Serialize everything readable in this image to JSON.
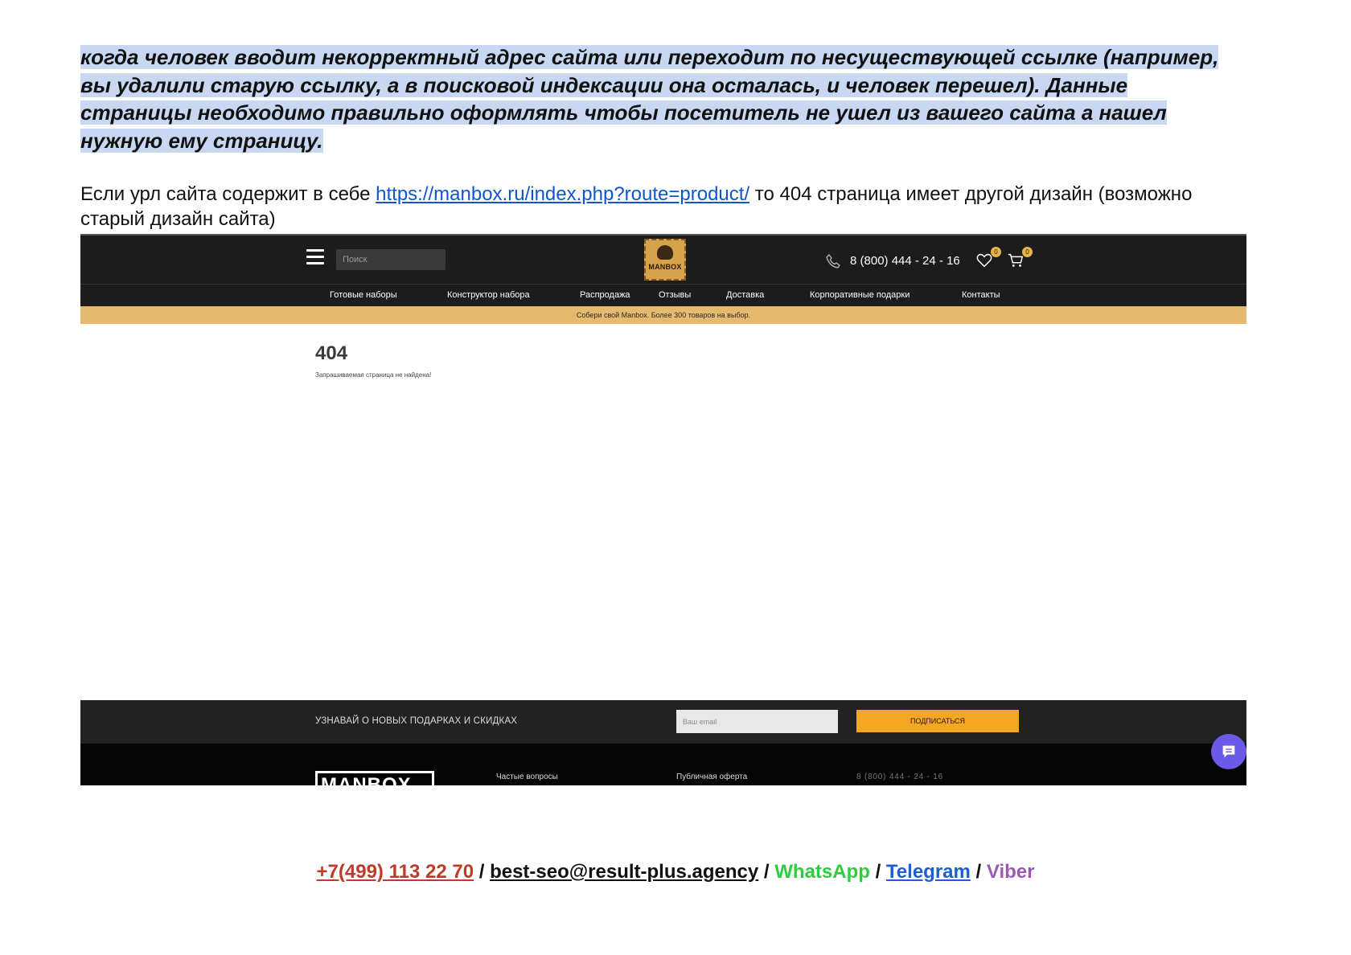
{
  "intro": {
    "lines": [
      "когда человек вводит некорректный адрес сайта или переходит по несуществующей ссылке (например,",
      "вы удалили старую ссылку, а в поисковой индексации она осталась, и человек перешел). Данные",
      "страницы необходимо правильно оформлять чтобы посетитель не ушел из вашего сайта а нашел",
      "нужную ему страницу."
    ]
  },
  "para": {
    "before": "Если урл сайта содержит в себе ",
    "link": "https://manbox.ru/index.php?route=product/",
    "after": " то 404 страница имеет другой дизайн (возможно старый дизайн сайта)"
  },
  "screenshot": {
    "search_placeholder": "Поиск",
    "logo_text": "MANBOX",
    "phone": "8 (800) 444 - 24 - 16",
    "wishlist_count": "0",
    "cart_count": "0",
    "menu": [
      "Готовые наборы",
      "Конструктор набора",
      "Распродажа",
      "Отзывы",
      "Доставка",
      "Корпоративные подарки",
      "Контакты"
    ],
    "promo": "Собери свой Manbox. Более 300 товаров на выбор.",
    "error_code": "404",
    "error_message": "Запрашиваемая страница не найдена!",
    "subscribe_title": "УЗНАВАЙ О НОВЫХ ПОДАРКАХ И СКИДКАХ",
    "email_placeholder": "Ваш email",
    "subscribe_button": "ПОДПИСАТЬСЯ",
    "footer_logo": "MANBOX",
    "footer_links": [
      "Частые вопросы",
      "Публичная оферта"
    ],
    "footer_phone": "8 (800) 444 - 24 - 16",
    "accent_color": "#e5b96e",
    "button_color": "#f5a623",
    "chat_color": "#6b5ae6"
  },
  "contacts": {
    "phone": "+7(499) 113 22 70",
    "email": "best-seo@result-plus.agency",
    "whatsapp": "WhatsApp",
    "telegram": "Telegram",
    "viber": "Viber",
    "separator": " / "
  }
}
